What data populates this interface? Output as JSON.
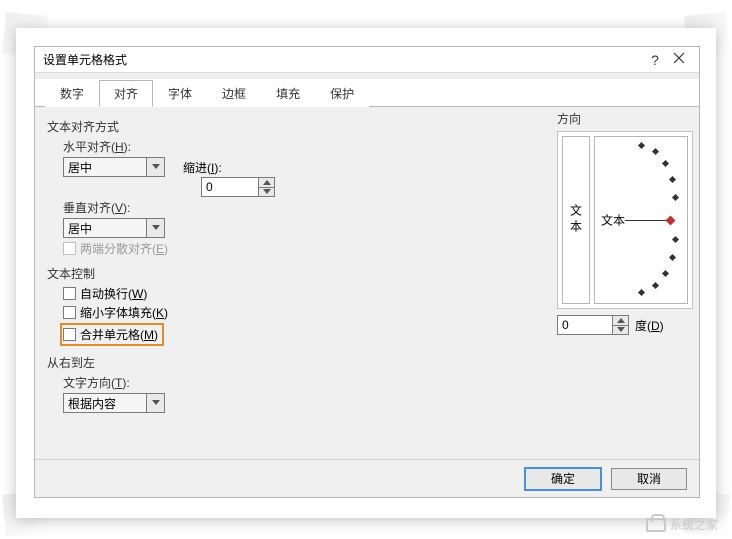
{
  "dialog": {
    "title": "设置单元格格式",
    "help_symbol": "?",
    "tabs": [
      "数字",
      "对齐",
      "字体",
      "边框",
      "填充",
      "保护"
    ],
    "active_tab_index": 1
  },
  "alignment": {
    "group_text_align": "文本对齐方式",
    "h_label_pre": "水平对齐(",
    "h_label_key": "H",
    "h_label_post": "):",
    "h_value": "居中",
    "indent_label_pre": "缩进(",
    "indent_label_key": "I",
    "indent_label_post": "):",
    "indent_value": "0",
    "v_label_pre": "垂直对齐(",
    "v_label_key": "V",
    "v_label_post": "):",
    "v_value": "居中",
    "justify_dist_pre": "两端分散对齐(",
    "justify_dist_key": "E",
    "justify_dist_post": ")"
  },
  "text_control": {
    "group": "文本控制",
    "wrap_pre": "自动换行(",
    "wrap_key": "W",
    "wrap_post": ")",
    "shrink_pre": "缩小字体填充(",
    "shrink_key": "K",
    "shrink_post": ")",
    "merge_pre": "合并单元格(",
    "merge_key": "M",
    "merge_post": ")"
  },
  "rtl": {
    "group": "从右到左",
    "dir_label_pre": "文字方向(",
    "dir_label_key": "T",
    "dir_label_post": "):",
    "dir_value": "根据内容"
  },
  "orientation": {
    "group": "方向",
    "vertical_text": "文本",
    "dial_text": "文本",
    "degree_value": "0",
    "degree_label_pre": "度(",
    "degree_label_key": "D",
    "degree_label_post": ")"
  },
  "buttons": {
    "ok": "确定",
    "cancel": "取消"
  },
  "watermark": "系统之家"
}
